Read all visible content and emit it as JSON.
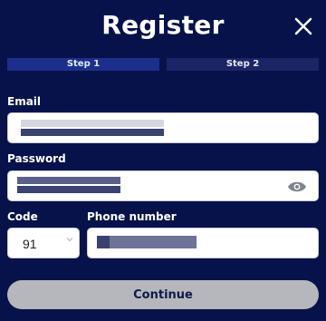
{
  "header": {
    "title": "Register"
  },
  "steps": [
    {
      "label": "Step 1"
    },
    {
      "label": "Step 2"
    }
  ],
  "form": {
    "email_label": "Email",
    "password_label": "Password",
    "code_label": "Code",
    "code_value": "91",
    "phone_label": "Phone number"
  },
  "actions": {
    "continue_label": "Continue"
  },
  "colors": {
    "background": "#07124a",
    "step_active": "#1c2f8c",
    "step_inactive": "#1b2566",
    "button": "#b6b7bc"
  }
}
